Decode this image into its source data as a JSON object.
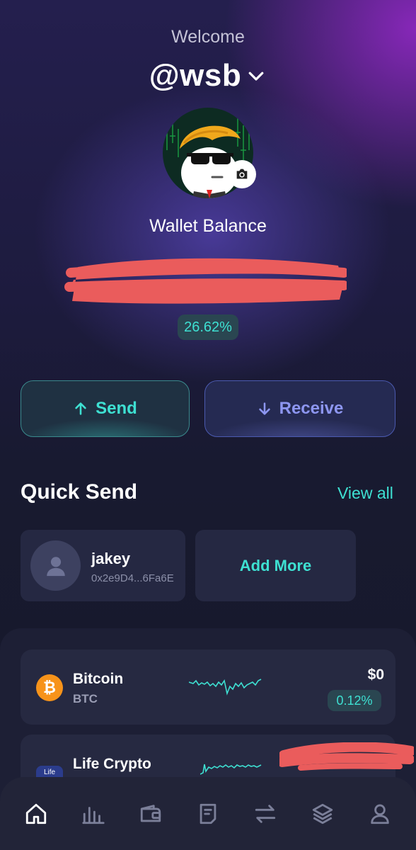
{
  "header": {
    "welcome": "Welcome",
    "username": "@wsb"
  },
  "profile": {
    "avatar_icon": "wsb-mascot-avatar",
    "camera_icon": "camera-icon"
  },
  "wallet": {
    "balance_label": "Wallet Balance",
    "change_percent": "26.62%"
  },
  "actions": {
    "send_label": "Send",
    "receive_label": "Receive"
  },
  "quick_send": {
    "title": "Quick Send",
    "view_all": "View all",
    "contacts": [
      {
        "name": "jakey",
        "address": "0x2e9D4...6Fa6E"
      }
    ],
    "add_more": "Add More"
  },
  "assets": [
    {
      "name": "Bitcoin",
      "symbol": "BTC",
      "value": "$0",
      "change": "0.12%",
      "icon": "bitcoin-icon"
    },
    {
      "name": "Life Crypto",
      "icon_text": "Life",
      "icon": "life-crypto-icon"
    }
  ],
  "nav": {
    "items": [
      "home-icon",
      "chart-icon",
      "wallet-icon",
      "ledger-icon",
      "swap-icon",
      "layers-icon",
      "profile-icon"
    ]
  },
  "colors": {
    "accent": "#3ee0d2",
    "receive": "#8d96f0",
    "bitcoin": "#f7931a",
    "redaction": "#ea5c5c"
  }
}
